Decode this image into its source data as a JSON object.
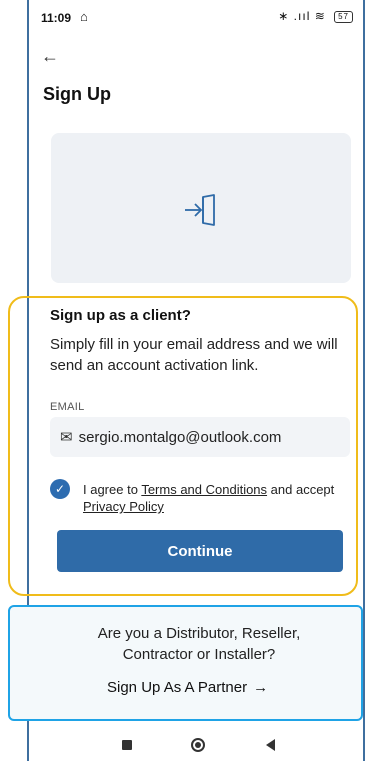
{
  "status_bar": {
    "time": "11:09",
    "home_icon": "⌂",
    "indicators": "∗ .ııl ≋",
    "battery": "57"
  },
  "header": {
    "back_icon": "←",
    "title": "Sign Up"
  },
  "illustration": {
    "icon": "sign-in-door-icon"
  },
  "client_section": {
    "title": "Sign up as a client?",
    "description": "Simply fill in your email address and we will send an account activation link.",
    "email_label": "EMAIL",
    "email_value": "sergio.montalgo@outlook.com",
    "agree_checked": true,
    "agree_prefix": "I agree to ",
    "terms_link": "Terms and Conditions",
    "agree_middle": " and accept ",
    "privacy_link": "Privacy Policy",
    "continue_label": "Continue"
  },
  "partner_section": {
    "question": "Are you a Distributor, Reseller, Contractor or Installer?",
    "link_label": "Sign Up As A Partner",
    "link_arrow": "→"
  },
  "colors": {
    "primary": "#2f6ba8",
    "client_outline": "#f0bc1a",
    "partner_outline": "#1fa3e6"
  }
}
